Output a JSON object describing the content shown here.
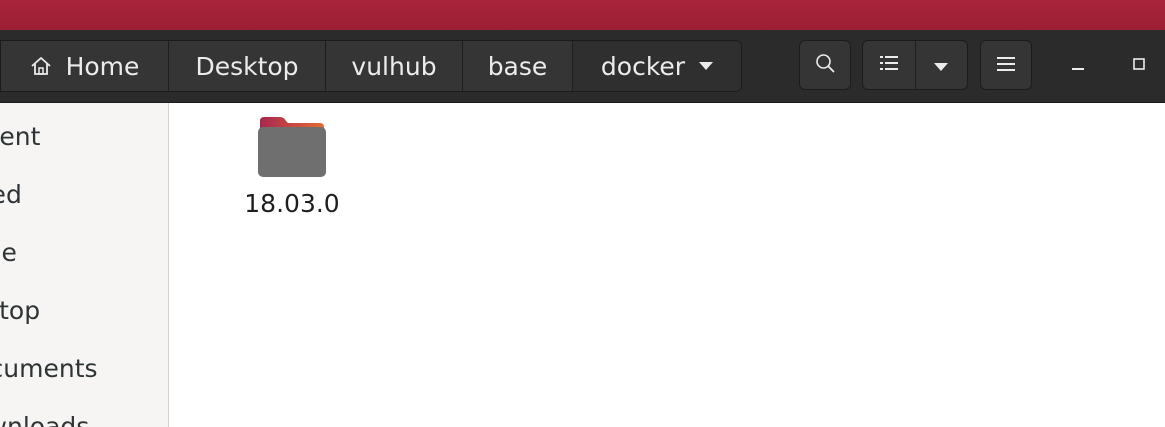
{
  "breadcrumb": {
    "items": [
      {
        "label": "Home",
        "icon": "home-icon"
      },
      {
        "label": "Desktop"
      },
      {
        "label": "vulhub"
      },
      {
        "label": "base"
      },
      {
        "label": "docker",
        "icon": "dropdown-triangle-icon"
      }
    ]
  },
  "toolbar": {
    "icons": [
      "search-icon",
      "list-view-icon",
      "view-options-dropdown-icon",
      "hamburger-menu-icon"
    ]
  },
  "window_controls": [
    "minimize-icon",
    "maximize-icon"
  ],
  "sidebar": {
    "items": [
      {
        "label": "Recent"
      },
      {
        "label": "Starred"
      },
      {
        "label": "Home"
      },
      {
        "label": "Desktop"
      },
      {
        "label": "Documents"
      },
      {
        "label": "Downloads"
      }
    ]
  },
  "files": [
    {
      "name": "18.03.0",
      "type": "folder"
    }
  ],
  "colors": {
    "titlebar": "#a8243a",
    "toolbar": "#2b2b2b",
    "folder_tab": "#c3476a",
    "folder_body": "#6f6f6f",
    "sidebar_bg": "#f6f5f4"
  }
}
